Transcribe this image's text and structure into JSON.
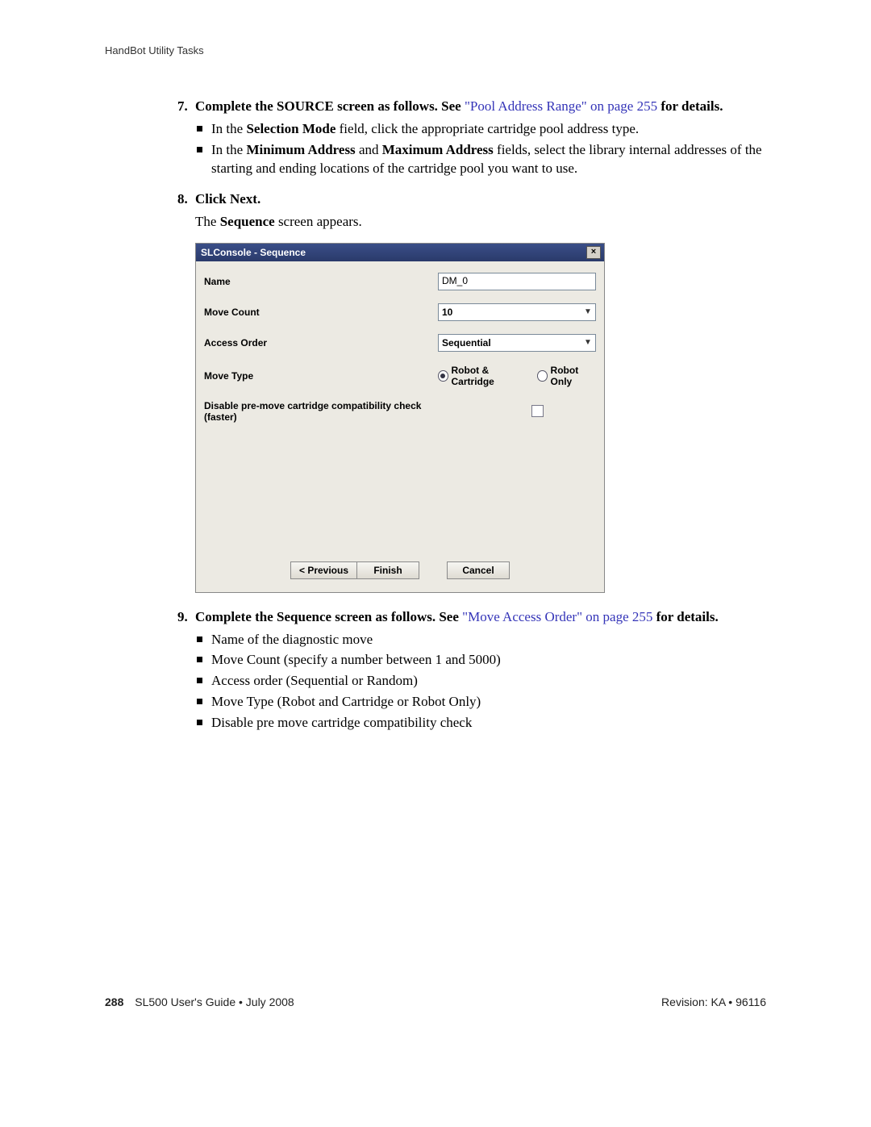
{
  "header": {
    "section": "HandBot Utility Tasks"
  },
  "steps": {
    "s7": {
      "num": "7.",
      "lead_bold": "Complete the SOURCE screen as follows. See ",
      "link": "\"Pool Address Range\" on page 255",
      "trail_bold": " for details.",
      "bullets": [
        {
          "pre": "In the ",
          "b1": "Selection Mode",
          "post": " field, click the appropriate cartridge pool address type."
        },
        {
          "pre": "In the ",
          "b1": "Minimum Address",
          "mid": " and ",
          "b2": "Maximum Address",
          "post": " fields, select the library internal addresses of the starting and ending locations of the cartridge pool you want to use."
        }
      ]
    },
    "s8": {
      "num": "8.",
      "head": "Click Next.",
      "body_pre": "The ",
      "body_b": "Sequence",
      "body_post": " screen appears."
    },
    "s9": {
      "num": "9.",
      "lead_bold": "Complete the Sequence screen as follows. See ",
      "link": "\"Move Access Order\" on page 255",
      "trail_bold": " for details.",
      "bullets": [
        "Name of the diagnostic move",
        "Move Count (specify a number between 1 and 5000)",
        "Access order (Sequential or Random)",
        "Move Type (Robot and Cartridge or Robot Only)",
        "Disable pre move cartridge compatibility check"
      ]
    }
  },
  "dialog": {
    "title": "SLConsole - Sequence",
    "close": "×",
    "name_lbl": "Name",
    "name_val": "DM_0",
    "count_lbl": "Move Count",
    "count_val": "10",
    "order_lbl": "Access Order",
    "order_val": "Sequential",
    "type_lbl": "Move Type",
    "radio1": "Robot & Cartridge",
    "radio2": "Robot Only",
    "disable_lbl": "Disable pre-move cartridge compatibility check (faster)",
    "prev": "< Previous",
    "finish": "Finish",
    "cancel": "Cancel"
  },
  "footer": {
    "page": "288",
    "left": "SL500 User's Guide  •  July 2008",
    "right": "Revision: KA  •  96116"
  }
}
